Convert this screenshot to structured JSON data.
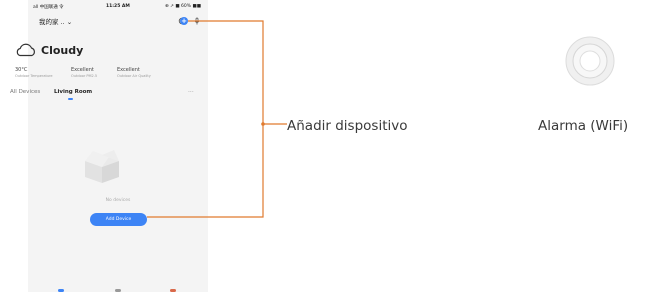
{
  "statusbar": {
    "carrier": "all 中国联通 令",
    "time": "11:25 AM",
    "battery": "⊕ ↗ ■ 60% ■■"
  },
  "header": {
    "home_name": "我的家 .. ⌄",
    "icons": [
      "scan-icon",
      "mic-icon",
      "add-icon"
    ],
    "add_symbol": "+"
  },
  "weather": {
    "condition": "Cloudy",
    "stats": [
      {
        "value": "30°C",
        "caption": "Outdoor Temperature"
      },
      {
        "value": "Excellent",
        "caption": "Outdoor PM2.5"
      },
      {
        "value": "Excellent",
        "caption": "Outdoor Air Quality"
      }
    ]
  },
  "tabs": {
    "all": "All Devices",
    "active": "Living Room",
    "more": "..."
  },
  "empty_state": {
    "text": "No devices",
    "button_label": "Add Device"
  },
  "callout": {
    "label": "Añadir dispositivo"
  },
  "product": {
    "caption": "Alarma (WiFi)"
  },
  "colors": {
    "accent": "#3d84f5",
    "connector": "#e07a2e"
  }
}
